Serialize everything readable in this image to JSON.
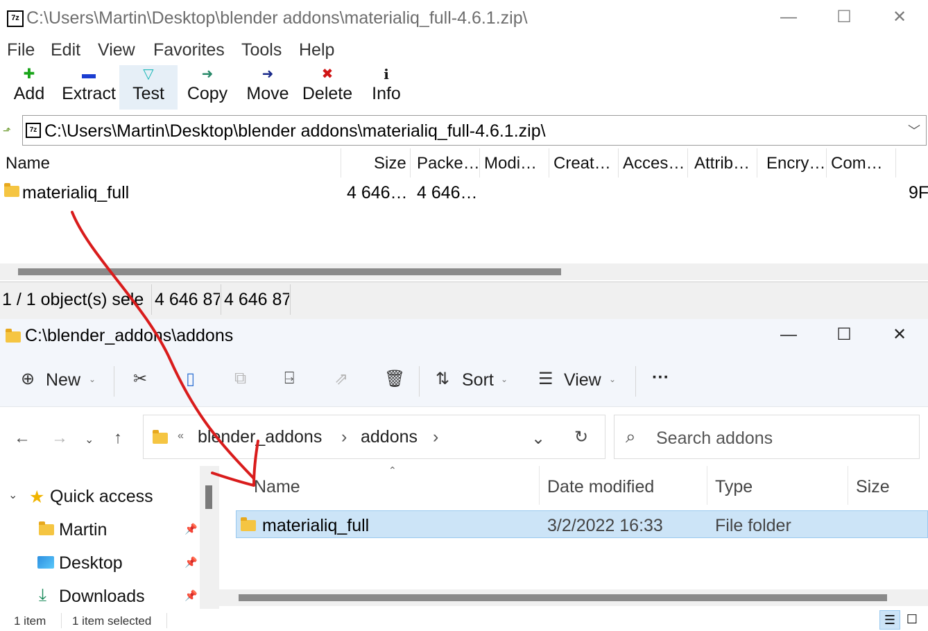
{
  "zip_window": {
    "title": "C:\\Users\\Martin\\Desktop\\blender addons\\materialiq_full-4.6.1.zip\\",
    "app_icon_text": "7z",
    "menu": [
      "File",
      "Edit",
      "View",
      "Favorites",
      "Tools",
      "Help"
    ],
    "toolbar": [
      {
        "label": "Add",
        "icon": "add-icon",
        "glyph": "✚",
        "color": "#1aa51a"
      },
      {
        "label": "Extract",
        "icon": "extract-icon",
        "glyph": "▬",
        "color": "#1a3dd1"
      },
      {
        "label": "Test",
        "icon": "test-icon",
        "glyph": "▽",
        "color": "#1cb8b8"
      },
      {
        "label": "Copy",
        "icon": "copy-icon",
        "glyph": "➜",
        "color": "#2a8a6a"
      },
      {
        "label": "Move",
        "icon": "move-icon",
        "glyph": "➜",
        "color": "#1a2a8a"
      },
      {
        "label": "Delete",
        "icon": "delete-icon",
        "glyph": "✖",
        "color": "#d01414"
      },
      {
        "label": "Info",
        "icon": "info-icon",
        "glyph": "i",
        "color": "#111111"
      }
    ],
    "address": "C:\\Users\\Martin\\Desktop\\blender addons\\materialiq_full-4.6.1.zip\\",
    "columns": [
      "Name",
      "Size",
      "Packe…",
      "Modi…",
      "Creat…",
      "Acces…",
      "Attrib…",
      "Encry…",
      "Com…"
    ],
    "row": {
      "name": "materialiq_full",
      "size": "4 646…",
      "packed": "4 646…",
      "trailing": "9F"
    },
    "status": [
      "1 / 1 object(s) sele",
      "4 646 87",
      "4 646 87"
    ]
  },
  "explorer_window": {
    "title": "C:\\blender_addons\\addons",
    "commands": {
      "new": "New",
      "sort": "Sort",
      "view": "View",
      "more": "···"
    },
    "breadcrumb": [
      "«",
      "blender_addons",
      "›",
      "addons",
      "›"
    ],
    "search_placeholder": "Search addons",
    "nav": [
      {
        "label": "Quick access",
        "icon": "star-icon"
      },
      {
        "label": "Martin",
        "icon": "folder-icon"
      },
      {
        "label": "Desktop",
        "icon": "desktop-icon"
      },
      {
        "label": "Downloads",
        "icon": "download-icon"
      }
    ],
    "columns": [
      "Name",
      "Date modified",
      "Type",
      "Size"
    ],
    "row": {
      "name": "materialiq_full",
      "date": "3/2/2022 16:33",
      "type": "File folder"
    },
    "status": {
      "count": "1 item",
      "selected": "1 item selected"
    }
  },
  "colors": {
    "arrow": "#d91c1c",
    "selection": "#cce4f7"
  }
}
